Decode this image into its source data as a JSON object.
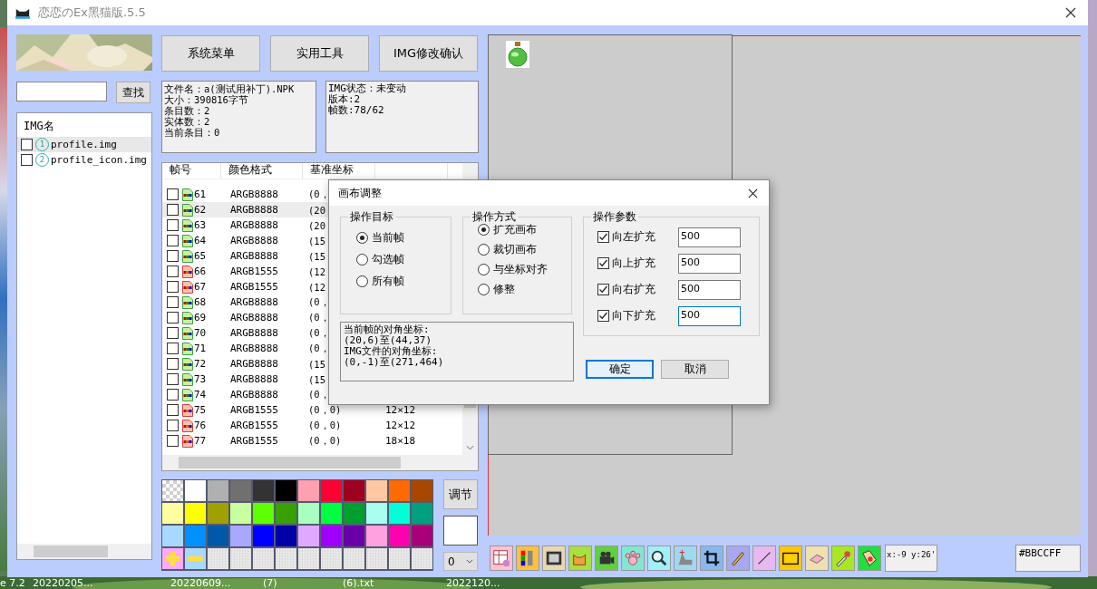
{
  "window": {
    "title": "恋恋のEx黑猫版.5.5"
  },
  "search": {
    "button": "查找"
  },
  "img_list": {
    "header": "IMG名",
    "items": [
      {
        "number": "1",
        "name": "profile.img",
        "checked": false,
        "selected": true
      },
      {
        "number": "2",
        "name": "profile_icon.img",
        "checked": false,
        "selected": false
      }
    ]
  },
  "buttons": [
    "系统菜单",
    "实用工具",
    "IMG修改确认"
  ],
  "file_info": [
    "文件名：a(测试用补丁).NPK",
    "大小：390816字节",
    "条目数：2",
    "实体数：2",
    "当前条目：0"
  ],
  "img_info": [
    "IMG状态：未变动",
    "版本:2",
    "帧数:78/62"
  ],
  "frames": {
    "columns": [
      "帧号",
      "颜色格式",
      "基准坐标"
    ],
    "rows": [
      {
        "number": "61",
        "kind": "argb8888",
        "format": "ARGB8888",
        "base": "(0，",
        "checked": false,
        "selected": false
      },
      {
        "number": "62",
        "kind": "argb8888",
        "format": "ARGB8888",
        "base": "(20",
        "checked": false,
        "selected": true
      },
      {
        "number": "63",
        "kind": "argb8888",
        "format": "ARGB8888",
        "base": "(20",
        "checked": false,
        "selected": false
      },
      {
        "number": "64",
        "kind": "argb8888",
        "format": "ARGB8888",
        "base": "(15",
        "checked": false,
        "selected": false
      },
      {
        "number": "65",
        "kind": "argb8888",
        "format": "ARGB8888",
        "base": "(15",
        "checked": false,
        "selected": false
      },
      {
        "number": "66",
        "kind": "argb1555",
        "format": "ARGB1555",
        "base": "(12",
        "checked": false,
        "selected": false
      },
      {
        "number": "67",
        "kind": "argb1555",
        "format": "ARGB1555",
        "base": "(12",
        "checked": false,
        "selected": false
      },
      {
        "number": "68",
        "kind": "argb8888",
        "format": "ARGB8888",
        "base": "(0，",
        "checked": false,
        "selected": false
      },
      {
        "number": "69",
        "kind": "argb8888",
        "format": "ARGB8888",
        "base": "(0，",
        "checked": false,
        "selected": false
      },
      {
        "number": "70",
        "kind": "argb8888",
        "format": "ARGB8888",
        "base": "(0，",
        "checked": false,
        "selected": false
      },
      {
        "number": "71",
        "kind": "argb8888",
        "format": "ARGB8888",
        "base": "(0，",
        "checked": false,
        "selected": false
      },
      {
        "number": "72",
        "kind": "argb8888",
        "format": "ARGB8888",
        "base": "(15",
        "checked": false,
        "selected": false
      },
      {
        "number": "73",
        "kind": "argb8888",
        "format": "ARGB8888",
        "base": "(15",
        "checked": false,
        "selected": false
      },
      {
        "number": "74",
        "kind": "argb8888",
        "format": "ARGB8888",
        "base": "(0，",
        "checked": false,
        "selected": false
      },
      {
        "number": "75",
        "kind": "argb1555",
        "format": "ARGB1555",
        "base": "(0，0)",
        "size": "12×12",
        "checked": false,
        "selected": false
      },
      {
        "number": "76",
        "kind": "argb1555",
        "format": "ARGB1555",
        "base": "(0，0)",
        "size": "12×12",
        "checked": false,
        "selected": false
      },
      {
        "number": "77",
        "kind": "argb1555",
        "format": "ARGB1555",
        "base": "(0，0)",
        "size": "18×18",
        "checked": false,
        "selected": false
      }
    ]
  },
  "palette": {
    "swatches": [
      {
        "kind": "transparent"
      },
      {
        "kind": "color",
        "color": "#ffffff"
      },
      {
        "kind": "color",
        "color": "#b0b0b0"
      },
      {
        "kind": "color",
        "color": "#707070"
      },
      {
        "kind": "color",
        "color": "#333333"
      },
      {
        "kind": "color",
        "color": "#000000"
      },
      {
        "kind": "color",
        "color": "#ffa0b0"
      },
      {
        "kind": "color",
        "color": "#ff0033"
      },
      {
        "kind": "color",
        "color": "#a00020"
      },
      {
        "kind": "color",
        "color": "#ffc8a0"
      },
      {
        "kind": "color",
        "color": "#ff6a00"
      },
      {
        "kind": "color",
        "color": "#a84800"
      },
      {
        "kind": "color",
        "color": "#ffffa0"
      },
      {
        "kind": "color",
        "color": "#ffff00"
      },
      {
        "kind": "color",
        "color": "#a0a000"
      },
      {
        "kind": "color",
        "color": "#c8ffa0"
      },
      {
        "kind": "color",
        "color": "#60ff00"
      },
      {
        "kind": "color",
        "color": "#38a000"
      },
      {
        "kind": "color",
        "color": "#a8ffc0"
      },
      {
        "kind": "color",
        "color": "#00ff40"
      },
      {
        "kind": "color",
        "color": "#00a030"
      },
      {
        "kind": "color",
        "color": "#a8fff0"
      },
      {
        "kind": "color",
        "color": "#00ffd8"
      },
      {
        "kind": "color",
        "color": "#00a080"
      },
      {
        "kind": "color",
        "color": "#a8d8ff"
      },
      {
        "kind": "color",
        "color": "#0090ff"
      },
      {
        "kind": "color",
        "color": "#0058a8"
      },
      {
        "kind": "color",
        "color": "#a8a8ff"
      },
      {
        "kind": "color",
        "color": "#0000ff"
      },
      {
        "kind": "color",
        "color": "#0000a8"
      },
      {
        "kind": "color",
        "color": "#e0a8ff"
      },
      {
        "kind": "color",
        "color": "#a000ff"
      },
      {
        "kind": "color",
        "color": "#6800a8"
      },
      {
        "kind": "color",
        "color": "#ffa0e0"
      },
      {
        "kind": "color",
        "color": "#ff00b0"
      },
      {
        "kind": "color",
        "color": "#a80078"
      },
      {
        "kind": "add"
      },
      {
        "kind": "remove"
      },
      {
        "kind": "empty"
      },
      {
        "kind": "empty"
      },
      {
        "kind": "empty"
      },
      {
        "kind": "empty"
      },
      {
        "kind": "empty"
      },
      {
        "kind": "empty"
      },
      {
        "kind": "empty"
      },
      {
        "kind": "empty"
      },
      {
        "kind": "empty"
      },
      {
        "kind": "empty"
      }
    ],
    "adjust_button": "调节",
    "layer": "0"
  },
  "toolbar": {
    "coordinates": "x:-9 y:26'",
    "color_code": "#BBCCFF"
  },
  "dialog": {
    "title": "画布调整",
    "target": {
      "legend": "操作目标",
      "options": [
        {
          "label": "当前帧",
          "selected": true
        },
        {
          "label": "勾选帧",
          "selected": false
        },
        {
          "label": "所有帧",
          "selected": false
        }
      ]
    },
    "mode": {
      "legend": "操作方式",
      "options": [
        {
          "label": "扩充画布",
          "selected": true
        },
        {
          "label": "裁切画布",
          "selected": false
        },
        {
          "label": "与坐标对齐",
          "selected": false
        },
        {
          "label": "修整",
          "selected": false
        }
      ]
    },
    "params": {
      "legend": "操作参数",
      "rows": [
        {
          "label": "向左扩充",
          "checked": true,
          "value": "500",
          "focused": false
        },
        {
          "label": "向上扩充",
          "checked": true,
          "value": "500",
          "focused": false
        },
        {
          "label": "向右扩充",
          "checked": true,
          "value": "500",
          "focused": false
        },
        {
          "label": "向下扩充",
          "checked": true,
          "value": "500",
          "focused": true
        }
      ]
    },
    "info": [
      "当前帧的对角坐标:",
      "(20,6)至(44,37)",
      "IMG文件的对角坐标:",
      "(0,-1)至(271,464)"
    ],
    "ok": "确定",
    "cancel": "取消"
  },
  "desktop": {
    "labels": [
      "e 7.2",
      "20220205...",
      "20220609...",
      "(7)",
      "(6).txt",
      "2022120..."
    ]
  }
}
